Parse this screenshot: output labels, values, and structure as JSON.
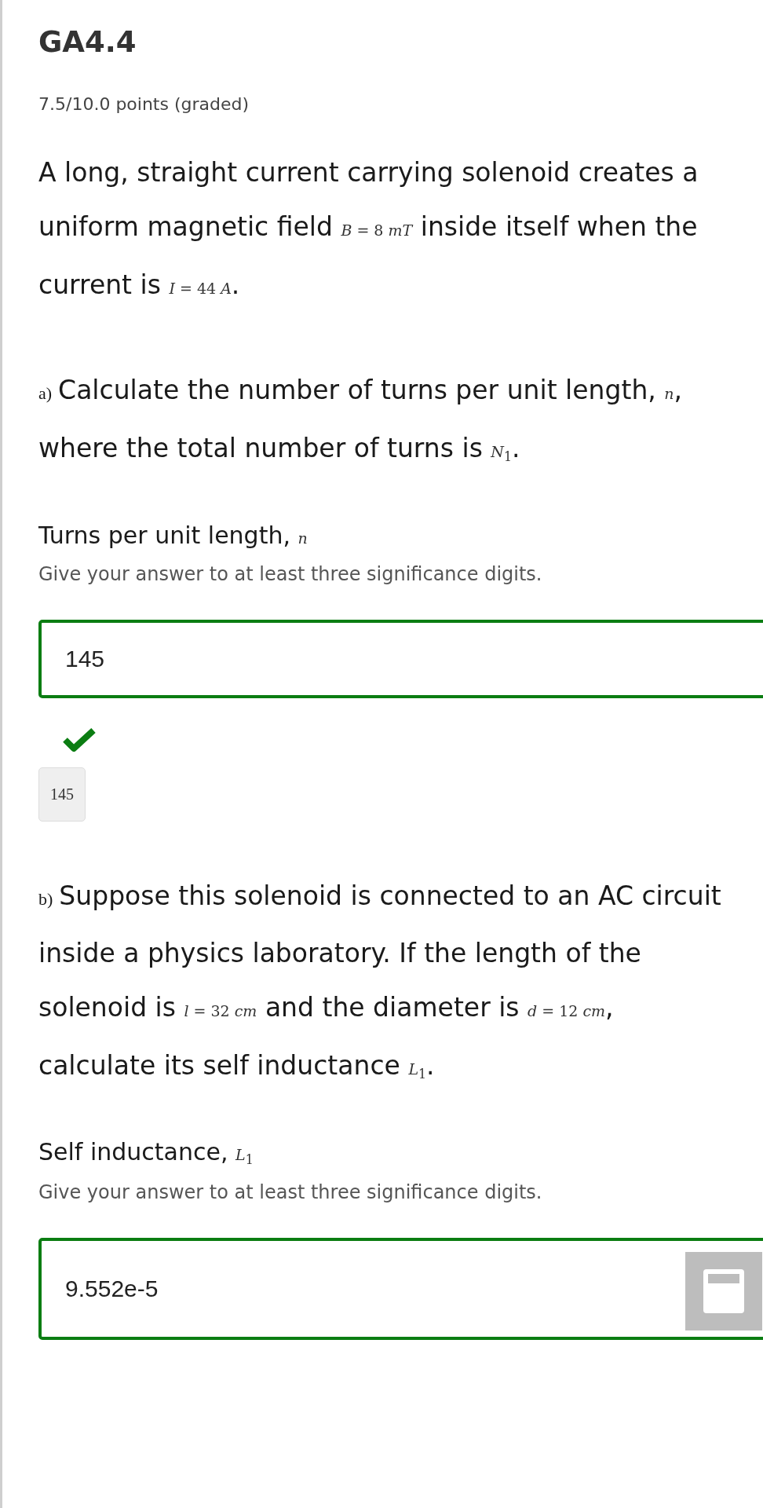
{
  "title": "GA4.4",
  "points": "7.5/10.0 points (graded)",
  "intro": [
    {
      "kind": "text",
      "text": "A long, straight current carrying solenoid creates a uniform magnetic field "
    },
    {
      "kind": "math",
      "text": "*B* = 8 *mT*"
    },
    {
      "kind": "text",
      "text": " inside itself when the current is "
    },
    {
      "kind": "math",
      "text": "*I* = 44 *A*"
    },
    {
      "kind": "text",
      "text": "."
    }
  ],
  "parts": [
    {
      "marker": "a)",
      "question": [
        {
          "kind": "text",
          "text": "Calculate the number of turns per unit length, "
        },
        {
          "kind": "math",
          "text": "*n*"
        },
        {
          "kind": "text",
          "text": ", where the total number of turns is "
        },
        {
          "kind": "math",
          "text": "*N*$_{1}$"
        },
        {
          "kind": "text",
          "text": "."
        }
      ],
      "label": "Turns per unit length, ",
      "label_math": "*n*",
      "hint": "Give your answer to at least three significance digits.",
      "answer": {
        "value": "145",
        "correct": true
      },
      "feedback": {
        "correct": true,
        "value": "145"
      }
    },
    {
      "marker": "b)",
      "question": [
        {
          "kind": "text",
          "text": "Suppose this solenoid is connected to an AC circuit inside a physics laboratory. If the length of the solenoid is "
        },
        {
          "kind": "math",
          "text": "*l* = 32 *cm*"
        },
        {
          "kind": "text",
          "text": " and the diameter is "
        },
        {
          "kind": "math",
          "text": "*d* = 12 *cm*"
        },
        {
          "kind": "text",
          "text": ", calculate its self inductance "
        },
        {
          "kind": "math",
          "text": "*L*$_{1}$"
        },
        {
          "kind": "text",
          "text": "."
        }
      ],
      "label": "Self inductance, ",
      "label_math": "*L*$_{1}$",
      "hint": "Give your answer to at least three significance digits.",
      "answer": {
        "value": "9.552e-5",
        "correct": true,
        "calculator": true
      }
    }
  ]
}
